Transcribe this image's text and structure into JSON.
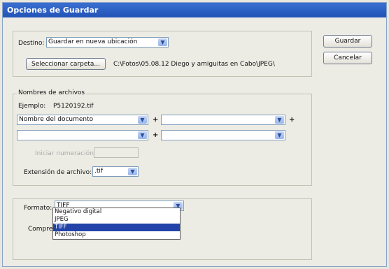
{
  "window": {
    "title": "Opciones de Guardar"
  },
  "buttons": {
    "save": "Guardar",
    "cancel": "Cancelar"
  },
  "destination": {
    "label": "Destino:",
    "value": "Guardar en nueva ubicación",
    "choose_folder": "Seleccionar carpeta...",
    "path": "C:\\Fotos\\05.08.12 Diego y amiguitas en Cabo\\JPEG\\"
  },
  "filenames": {
    "group_title": "Nombres de archivos",
    "example_label": "Ejemplo:",
    "example_value": "P5120192.tif",
    "row1": [
      "Nombre del documento",
      ""
    ],
    "row2": [
      "",
      ""
    ],
    "plus": "+",
    "start_numbering_label": "Iniciar numeración:",
    "extension_label": "Extensión de archivo:",
    "extension_value": ".tif"
  },
  "format": {
    "label": "Formato:",
    "value": "TIFF",
    "compression_label": "Compres",
    "options": [
      "Negativo digital",
      "JPEG",
      "TIFF",
      "Photoshop"
    ],
    "selected_index": 2
  }
}
